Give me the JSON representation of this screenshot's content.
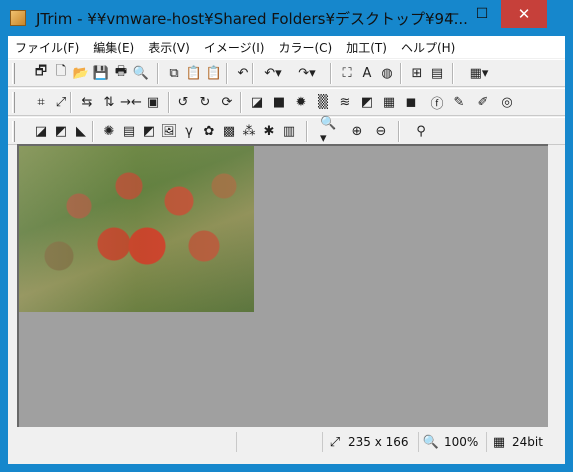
{
  "window": {
    "title": "JTrim - ¥¥vmware-host¥Shared Folders¥デスクトップ¥94...",
    "min_icon": "minimize-icon",
    "max_icon": "maximize-icon",
    "close_icon": "close-icon"
  },
  "menu": [
    "ファイル(F)",
    "編集(E)",
    "表示(V)",
    "イメージ(I)",
    "カラー(C)",
    "加工(T)",
    "ヘルプ(H)"
  ],
  "toolbar1": [
    {
      "name": "open-browser-icon",
      "glyph": "🗗"
    },
    {
      "name": "new-icon",
      "glyph": "🗋"
    },
    {
      "name": "open-icon",
      "glyph": "📂"
    },
    {
      "name": "save-icon",
      "glyph": "💾"
    },
    {
      "name": "print-icon",
      "glyph": "🖶"
    },
    {
      "name": "print-preview-icon",
      "glyph": "🔍"
    },
    {
      "name": "copy-icon",
      "glyph": "⧉"
    },
    {
      "name": "paste-icon",
      "glyph": "📋"
    },
    {
      "name": "paste-new-icon",
      "glyph": "📋"
    },
    {
      "name": "undo-all-icon",
      "glyph": "↶"
    },
    {
      "name": "undo-icon",
      "glyph": "↶▾"
    },
    {
      "name": "redo-icon",
      "glyph": "↷▾"
    },
    {
      "name": "fit-window-icon",
      "glyph": "⛶"
    },
    {
      "name": "text-icon",
      "glyph": "A"
    },
    {
      "name": "mosaic-icon",
      "glyph": "◍"
    },
    {
      "name": "tile-icon",
      "glyph": "⊞"
    },
    {
      "name": "filmstrip-icon",
      "glyph": "▤"
    },
    {
      "name": "palette-dropdown-icon",
      "glyph": "▦▾"
    }
  ],
  "toolbar2": [
    {
      "name": "crop-icon",
      "glyph": "⌗"
    },
    {
      "name": "resize-icon",
      "glyph": "⤢"
    },
    {
      "name": "flip-horizontal-icon",
      "glyph": "⇆"
    },
    {
      "name": "flip-vertical-icon",
      "glyph": "⇅"
    },
    {
      "name": "shrink-icon",
      "glyph": "→←"
    },
    {
      "name": "frame-icon",
      "glyph": "▣"
    },
    {
      "name": "rotate-left-90-icon",
      "glyph": "↺"
    },
    {
      "name": "rotate-right-90-icon",
      "glyph": "↻"
    },
    {
      "name": "rotate-free-icon",
      "glyph": "⟳"
    },
    {
      "name": "drop-shadow-icon",
      "glyph": "◪"
    },
    {
      "name": "bevel-icon",
      "glyph": "■"
    },
    {
      "name": "radial-blur-icon",
      "glyph": "✹"
    },
    {
      "name": "noise-icon",
      "glyph": "▒"
    },
    {
      "name": "wave-icon",
      "glyph": "≋"
    },
    {
      "name": "emboss-icon",
      "glyph": "◩"
    },
    {
      "name": "brick-icon",
      "glyph": "▦"
    },
    {
      "name": "spotlight-icon",
      "glyph": "◼"
    },
    {
      "name": "sharpen-icon",
      "glyph": "ⓕ"
    },
    {
      "name": "pen-icon",
      "glyph": "✎"
    },
    {
      "name": "watercolor-icon",
      "glyph": "✐"
    },
    {
      "name": "spiral-icon",
      "glyph": "◎"
    }
  ],
  "toolbar3": [
    {
      "name": "grayscale-icon",
      "glyph": "◪"
    },
    {
      "name": "sepia-icon",
      "glyph": "◩"
    },
    {
      "name": "negative-icon",
      "glyph": "◣"
    },
    {
      "name": "brightness-icon",
      "glyph": "✺"
    },
    {
      "name": "rgb-balance-icon",
      "glyph": "▤"
    },
    {
      "name": "contrast-icon",
      "glyph": "◩"
    },
    {
      "name": "picture-icon",
      "glyph": "🖼"
    },
    {
      "name": "gamma-icon",
      "glyph": "γ"
    },
    {
      "name": "color-wheel-icon",
      "glyph": "✿"
    },
    {
      "name": "dither-icon",
      "glyph": "▩"
    },
    {
      "name": "rgb-split-icon",
      "glyph": "⁂"
    },
    {
      "name": "xor-icon",
      "glyph": "✱"
    },
    {
      "name": "gradient-icon",
      "glyph": "▥"
    },
    {
      "name": "zoom-dropdown-icon",
      "glyph": "🔍▾"
    },
    {
      "name": "zoom-in-icon",
      "glyph": "⊕"
    },
    {
      "name": "zoom-out-icon",
      "glyph": "⊖"
    },
    {
      "name": "eyedropper-icon",
      "glyph": "⚲"
    }
  ],
  "status": {
    "size_icon": "image-size-icon",
    "size": "235 x 166",
    "zoom_icon": "zoom-icon",
    "zoom": "100%",
    "depth_icon": "color-depth-icon",
    "depth": "24bit"
  }
}
